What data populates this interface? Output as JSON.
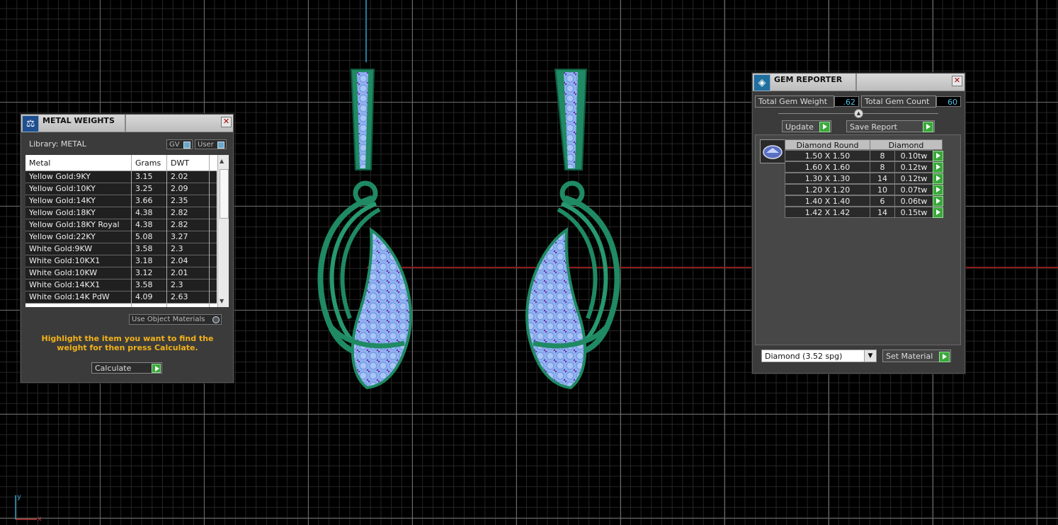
{
  "metal_weights": {
    "title": "METAL WEIGHTS",
    "library_label": "Library: METAL",
    "gv_label": "GV",
    "user_label": "User",
    "columns": [
      "Metal",
      "Grams",
      "DWT"
    ],
    "rows": [
      {
        "metal": "Yellow Gold:9KY",
        "grams": "3.15",
        "dwt": "2.02"
      },
      {
        "metal": "Yellow Gold:10KY",
        "grams": "3.25",
        "dwt": "2.09"
      },
      {
        "metal": "Yellow Gold:14KY",
        "grams": "3.66",
        "dwt": "2.35"
      },
      {
        "metal": "Yellow Gold:18KY",
        "grams": "4.38",
        "dwt": "2.82"
      },
      {
        "metal": "Yellow Gold:18KY Royal",
        "grams": "4.38",
        "dwt": "2.82"
      },
      {
        "metal": "Yellow Gold:22KY",
        "grams": "5.08",
        "dwt": "3.27"
      },
      {
        "metal": "White Gold:9KW",
        "grams": "3.58",
        "dwt": "2.3"
      },
      {
        "metal": "White Gold:10KX1",
        "grams": "3.18",
        "dwt": "2.04"
      },
      {
        "metal": "White Gold:10KW",
        "grams": "3.12",
        "dwt": "2.01"
      },
      {
        "metal": "White Gold:14KX1",
        "grams": "3.58",
        "dwt": "2.3"
      },
      {
        "metal": "White Gold:14K PdW",
        "grams": "4.09",
        "dwt": "2.63"
      }
    ],
    "use_object_materials": "Use Object Materials",
    "hint": "Highlight the item you want to find the weight for then press Calculate.",
    "calculate_label": "Calculate"
  },
  "gem_reporter": {
    "title": "GEM REPORTER",
    "total_weight_label": "Total Gem Weight",
    "total_weight_value": ".62",
    "total_count_label": "Total Gem Count",
    "total_count_value": "60",
    "update_label": "Update",
    "save_report_label": "Save Report",
    "columns": [
      "Diamond Round",
      "Diamond"
    ],
    "rows": [
      {
        "size": "1.50 X 1.50",
        "count": "8",
        "weight": "0.10tw"
      },
      {
        "size": "1.60 X 1.60",
        "count": "8",
        "weight": "0.12tw"
      },
      {
        "size": "1.30 X 1.30",
        "count": "14",
        "weight": "0.12tw"
      },
      {
        "size": "1.20 X 1.20",
        "count": "10",
        "weight": "0.07tw"
      },
      {
        "size": "1.40 X 1.40",
        "count": "6",
        "weight": "0.06tw"
      },
      {
        "size": "1.42 X 1.42",
        "count": "14",
        "weight": "0.15tw"
      }
    ],
    "material_select": "Diamond    (3.52 spg)",
    "set_material_label": "Set Material"
  },
  "axis_labels": {
    "y": "y",
    "x": "x"
  },
  "colors": {
    "metal_green": "#1f8a63",
    "gem_blue": "#7fa8f0",
    "gem_purple": "#6b2fa0",
    "hint_orange": "#f2b21a",
    "value_cyan": "#4fc3e6"
  }
}
